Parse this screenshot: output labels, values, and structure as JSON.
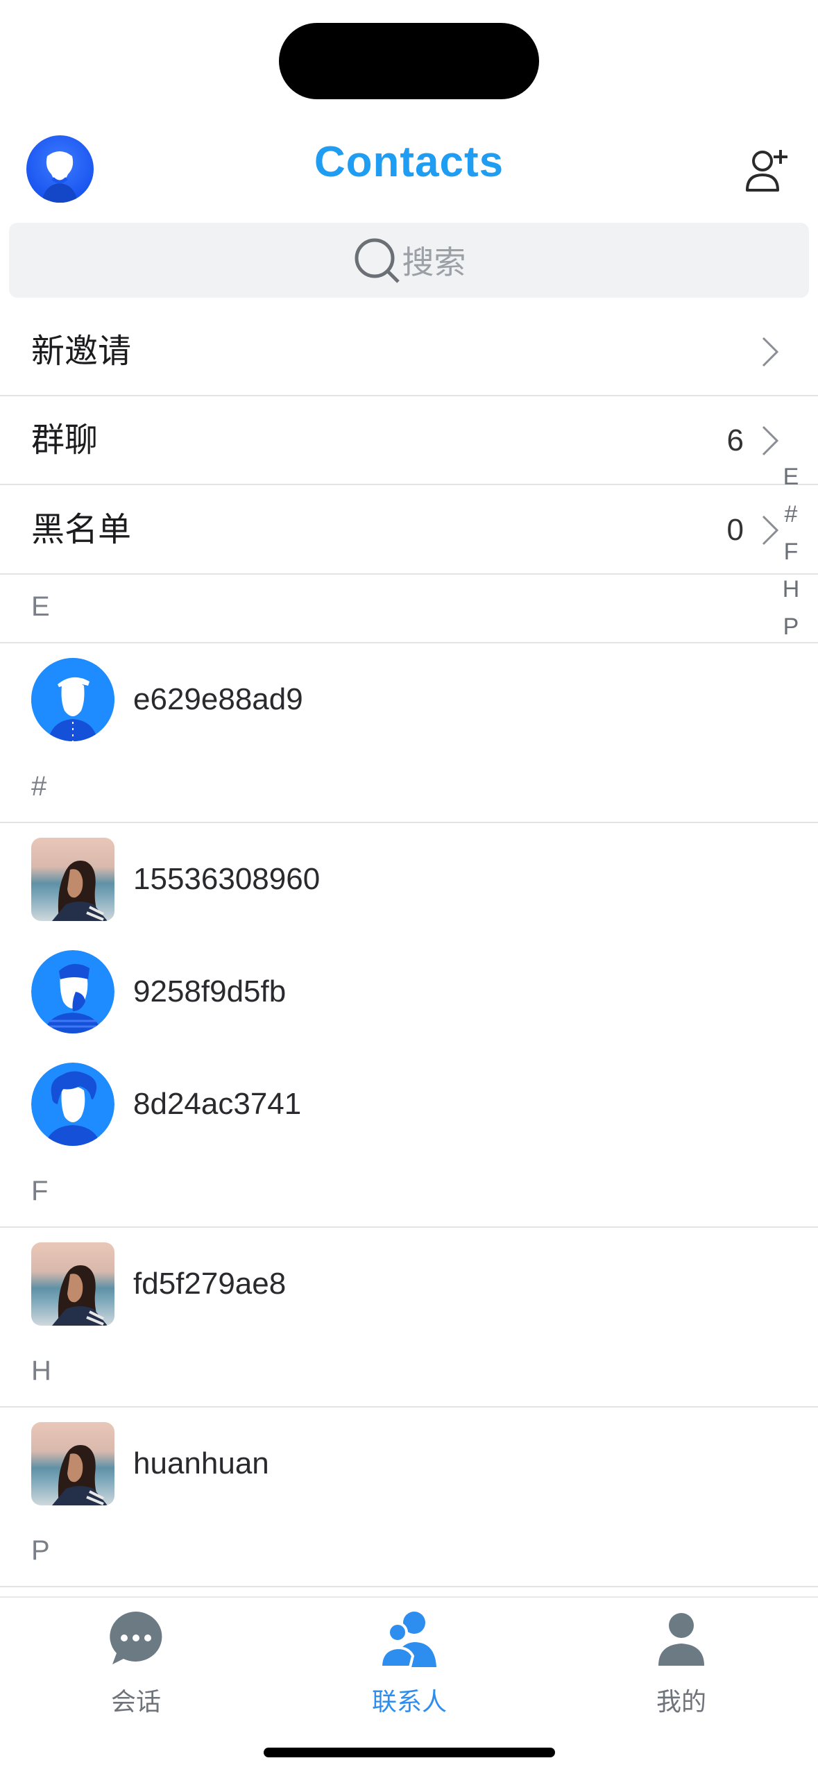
{
  "header": {
    "title": "Contacts"
  },
  "search": {
    "placeholder": "搜索"
  },
  "menu": [
    {
      "label": "新邀请",
      "count": ""
    },
    {
      "label": "群聊",
      "count": "6"
    },
    {
      "label": "黑名单",
      "count": "0"
    }
  ],
  "sections": [
    {
      "letter": "E",
      "contacts": [
        {
          "name": "e629e88ad9",
          "avatar": "blue-cap-person-icon"
        }
      ]
    },
    {
      "letter": "#",
      "contacts": [
        {
          "name": "15536308960",
          "avatar": "photo-woman"
        },
        {
          "name": "9258f9d5fb",
          "avatar": "blue-beard-person-icon"
        },
        {
          "name": "8d24ac3741",
          "avatar": "blue-curly-person-icon"
        }
      ]
    },
    {
      "letter": "F",
      "contacts": [
        {
          "name": "fd5f279ae8",
          "avatar": "photo-woman"
        }
      ]
    },
    {
      "letter": "H",
      "contacts": [
        {
          "name": "huanhuan",
          "avatar": "photo-woman"
        }
      ]
    },
    {
      "letter": "P",
      "contacts": []
    }
  ],
  "index_bar": [
    "E",
    "#",
    "F",
    "H",
    "P"
  ],
  "tabs": [
    {
      "label": "会话",
      "icon": "chat-bubble-icon",
      "active": false
    },
    {
      "label": "联系人",
      "icon": "contacts-icon",
      "active": true
    },
    {
      "label": "我的",
      "icon": "profile-icon",
      "active": false
    }
  ],
  "colors": {
    "accent": "#1f9df2",
    "tab_active": "#2d8ef0",
    "avatar_blue": "#1a56f0"
  }
}
